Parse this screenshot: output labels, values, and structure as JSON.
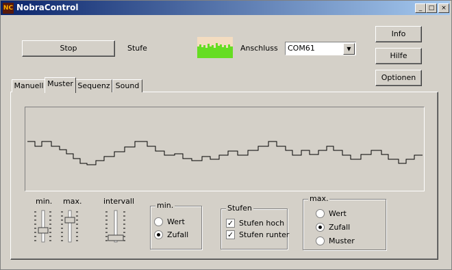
{
  "window": {
    "title": "NobraControl",
    "icon": "nc-app-icon"
  },
  "titlebar_buttons": {
    "minimize": "_",
    "maximize": "□",
    "close": "×"
  },
  "top": {
    "stop_label": "Stop",
    "stufe_label": "Stufe",
    "anschluss_label": "Anschluss",
    "port_value": "COM61",
    "info_label": "Info",
    "hilfe_label": "Hilfe",
    "optionen_label": "Optionen"
  },
  "tabs": [
    {
      "label": "Manuell",
      "active": false
    },
    {
      "label": "Muster",
      "active": true
    },
    {
      "label": "Sequenz",
      "active": false
    },
    {
      "label": "Sound",
      "active": false
    }
  ],
  "sliders": {
    "min_label": "min.",
    "max_label": "max.",
    "intervall_label": "intervall"
  },
  "group_min": {
    "title": "min.",
    "option1": "Wert",
    "option2": "Zufall",
    "selected": "Zufall"
  },
  "group_stufen": {
    "title": "Stufen",
    "option1": "Stufen hoch",
    "option2": "Stufen runter",
    "checked1": true,
    "checked2": true
  },
  "group_max": {
    "title": "max.",
    "option1": "Wert",
    "option2": "Zufall",
    "option3": "Muster",
    "selected": "Zufall"
  },
  "colors": {
    "titlebar_start": "#0a246a",
    "titlebar_end": "#a6caf0",
    "level_indicator": "#66dd22"
  }
}
